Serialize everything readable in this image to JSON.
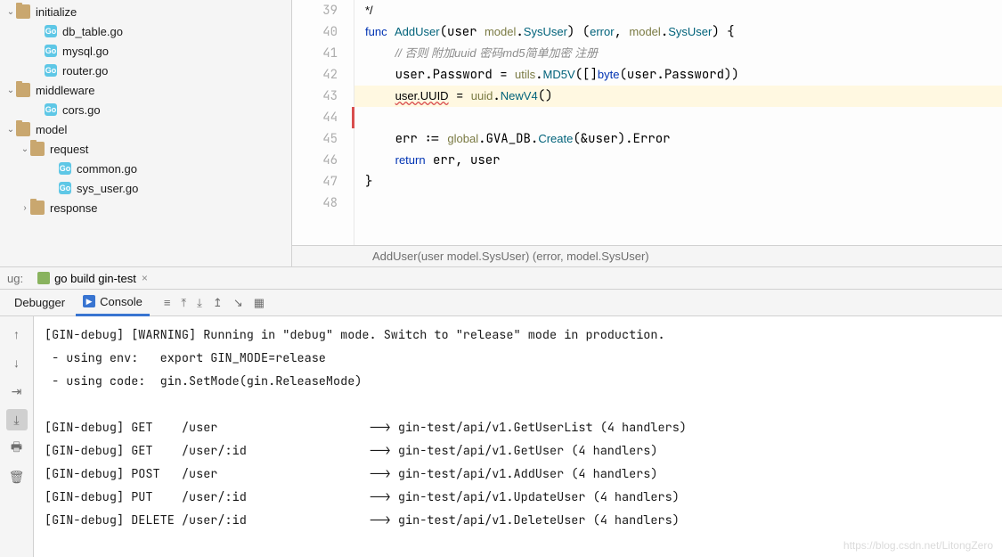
{
  "sidebar": {
    "items": [
      {
        "label": "initialize",
        "type": "folder",
        "indent": 0,
        "caret": "v"
      },
      {
        "label": "db_table.go",
        "type": "go",
        "indent": 2,
        "caret": ""
      },
      {
        "label": "mysql.go",
        "type": "go",
        "indent": 2,
        "caret": ""
      },
      {
        "label": "router.go",
        "type": "go",
        "indent": 2,
        "caret": ""
      },
      {
        "label": "middleware",
        "type": "folder",
        "indent": 0,
        "caret": "v"
      },
      {
        "label": "cors.go",
        "type": "go",
        "indent": 2,
        "caret": ""
      },
      {
        "label": "model",
        "type": "folder",
        "indent": 0,
        "caret": "v"
      },
      {
        "label": "request",
        "type": "folder",
        "indent": 1,
        "caret": "v"
      },
      {
        "label": "common.go",
        "type": "go",
        "indent": 3,
        "caret": ""
      },
      {
        "label": "sys_user.go",
        "type": "go",
        "indent": 3,
        "caret": ""
      },
      {
        "label": "response",
        "type": "folder",
        "indent": 1,
        "caret": ">"
      }
    ]
  },
  "editor": {
    "lines": [
      {
        "n": 39,
        "html": "<span class='op'>*/</span>"
      },
      {
        "n": 40,
        "html": "<span class='kw'>func</span> <span class='fn'>AddUser</span>(user <span class='pkg'>model</span>.<span class='typ'>SysUser</span>) (<span class='typ'>error</span>, <span class='pkg'>model</span>.<span class='typ'>SysUser</span>) {"
      },
      {
        "n": 41,
        "html": "    <span class='cmt'>// 否则 附加uuid 密码md5简单加密 注册</span>"
      },
      {
        "n": 42,
        "html": "    user.Password = <span class='pkg'>utils</span>.<span class='fn'>MD5V</span>([]<span class='kw'>byte</span>(user.Password))"
      },
      {
        "n": 43,
        "html": "    <span class='err-underline'>user.UUID</span> = <span class='pkg'>uuid</span>.<span class='fn'>NewV4</span>()",
        "hl": true
      },
      {
        "n": 44,
        "html": "",
        "red": true
      },
      {
        "n": 45,
        "html": "    err := <span class='pkg'>global</span>.GVA_DB.<span class='fn'>Create</span>(&amp;user).Error"
      },
      {
        "n": 46,
        "html": "    <span class='kw'>return</span> err, user"
      },
      {
        "n": 47,
        "html": "}"
      },
      {
        "n": 48,
        "html": ""
      }
    ],
    "breadcrumb": "AddUser(user model.SysUser) (error, model.SysUser)"
  },
  "debugHeader": {
    "label": "ug:",
    "runTab": "go build gin-test"
  },
  "tabs": {
    "debugger": "Debugger",
    "console": "Console"
  },
  "console": {
    "lines": [
      "[GIN-debug] [WARNING] Running in \"debug\" mode. Switch to \"release\" mode in production.",
      " - using env:   export GIN_MODE=release",
      " - using code:  gin.SetMode(gin.ReleaseMode)",
      "",
      "[GIN-debug] GET    /user                     --> gin-test/api/v1.GetUserList (4 handlers)",
      "[GIN-debug] GET    /user/:id                 --> gin-test/api/v1.GetUser (4 handlers)",
      "[GIN-debug] POST   /user                     --> gin-test/api/v1.AddUser (4 handlers)",
      "[GIN-debug] PUT    /user/:id                 --> gin-test/api/v1.UpdateUser (4 handlers)",
      "[GIN-debug] DELETE /user/:id                 --> gin-test/api/v1.DeleteUser (4 handlers)"
    ]
  },
  "watermark": "https://blog.csdn.net/LitongZero"
}
